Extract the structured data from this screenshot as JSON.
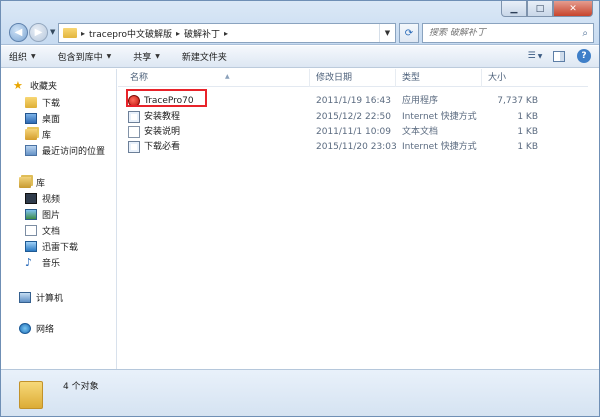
{
  "address": {
    "crumbs": [
      "tracepro中文破解版",
      "破解补丁"
    ]
  },
  "search": {
    "placeholder": "搜索 破解补丁"
  },
  "toolbar": {
    "organize": "组织",
    "include_library": "包含到库中",
    "share": "共享",
    "new_folder": "新建文件夹"
  },
  "sidebar": {
    "favorites": "收藏夹",
    "fav_items": [
      "下载",
      "桌面",
      "库",
      "最近访问的位置"
    ],
    "libraries": "库",
    "lib_items": [
      "视频",
      "图片",
      "文档",
      "迅雷下载",
      "音乐"
    ],
    "computer": "计算机",
    "network": "网络"
  },
  "columns": {
    "name": "名称",
    "date": "修改日期",
    "type": "类型",
    "size": "大小"
  },
  "files": [
    {
      "name": "TracePro70",
      "date": "2011/1/19 16:43",
      "type": "应用程序",
      "size": "7,737 KB",
      "icon": "app-icon"
    },
    {
      "name": "安装教程",
      "date": "2015/12/2 22:50",
      "type": "Internet 快捷方式",
      "size": "1 KB",
      "icon": "shortcut-icon"
    },
    {
      "name": "安装说明",
      "date": "2011/11/1 10:09",
      "type": "文本文档",
      "size": "1 KB",
      "icon": "text-file-icon"
    },
    {
      "name": "下载必看",
      "date": "2015/11/20 23:03",
      "type": "Internet 快捷方式",
      "size": "1 KB",
      "icon": "shortcut-icon"
    }
  ],
  "status": {
    "count": "4 个对象"
  },
  "colors": {
    "highlight": "#e8232a",
    "accent": "#3f7fc8"
  }
}
